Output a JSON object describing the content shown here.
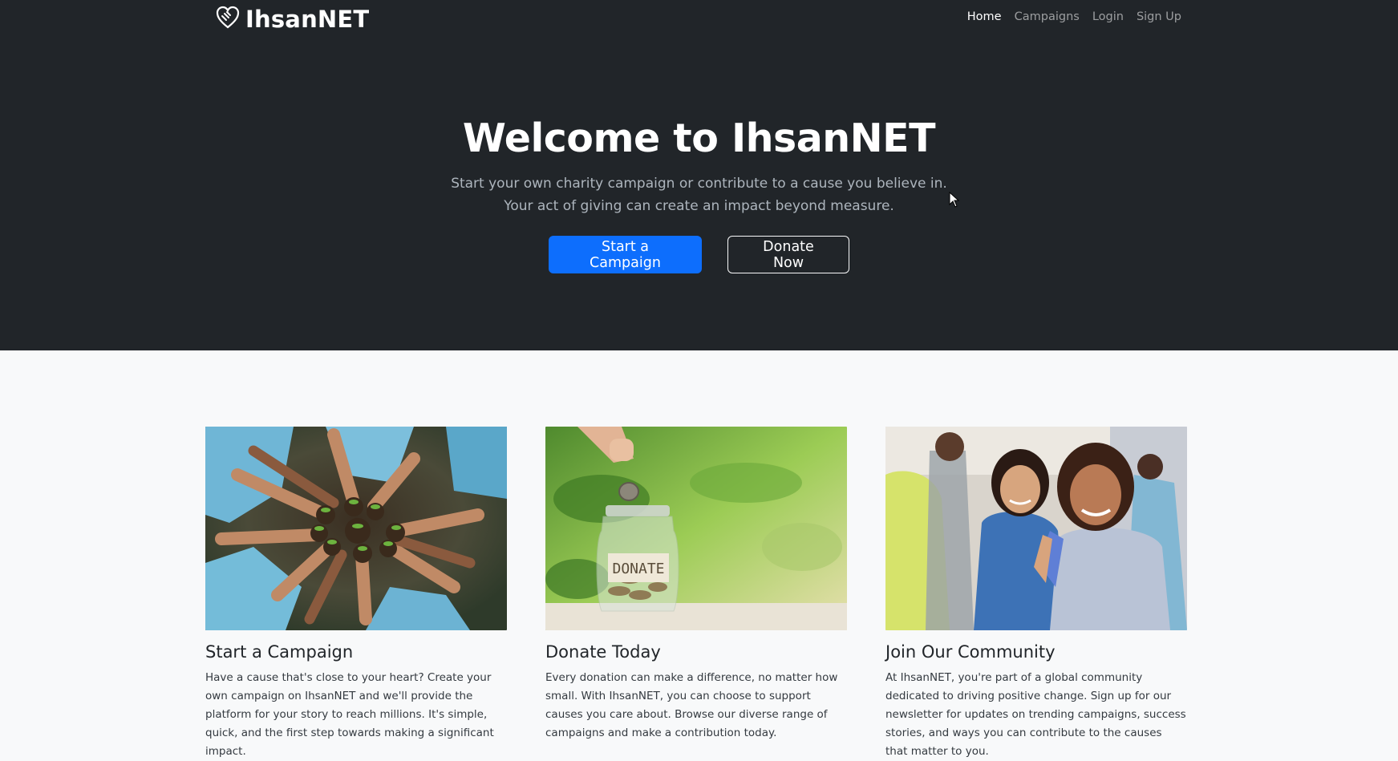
{
  "brand": {
    "name": "IhsanNET",
    "icon": "heart-hand-icon"
  },
  "nav": {
    "items": [
      {
        "label": "Home",
        "active": true
      },
      {
        "label": "Campaigns",
        "active": false
      },
      {
        "label": "Login",
        "active": false
      },
      {
        "label": "Sign Up",
        "active": false
      }
    ]
  },
  "hero": {
    "title": "Welcome to IhsanNET",
    "lead_line1": "Start your own charity campaign or contribute to a cause you believe in.",
    "lead_line2": "Your act of giving can create an impact beyond measure.",
    "primary_button": "Start a Campaign",
    "secondary_button": "Donate Now"
  },
  "features": [
    {
      "title": "Start a Campaign",
      "text": "Have a cause that's close to your heart? Create your own campaign on IhsanNET and we'll provide the platform for your story to reach millions. It's simple, quick, and the first step towards making a significant impact.",
      "image": "volunteers-holding-seedlings"
    },
    {
      "title": "Donate Today",
      "text": "Every donation can make a difference, no matter how small. With IhsanNET, you can choose to support causes you care about. Browse our diverse range of campaigns and make a contribution today.",
      "image": "coin-into-donate-jar",
      "jar_label": "DONATE"
    },
    {
      "title": "Join Our Community",
      "text": "At IhsanNET, you're part of a global community dedicated to driving positive change. Sign up for our newsletter for updates on trending campaigns, success stories, and ways you can contribute to the causes that matter to you.",
      "image": "volunteer-and-girl-high-five"
    }
  ],
  "colors": {
    "dark": "#212529",
    "primary": "#0d6efd",
    "light": "#f8f9fa",
    "muted": "#adb5bd"
  }
}
